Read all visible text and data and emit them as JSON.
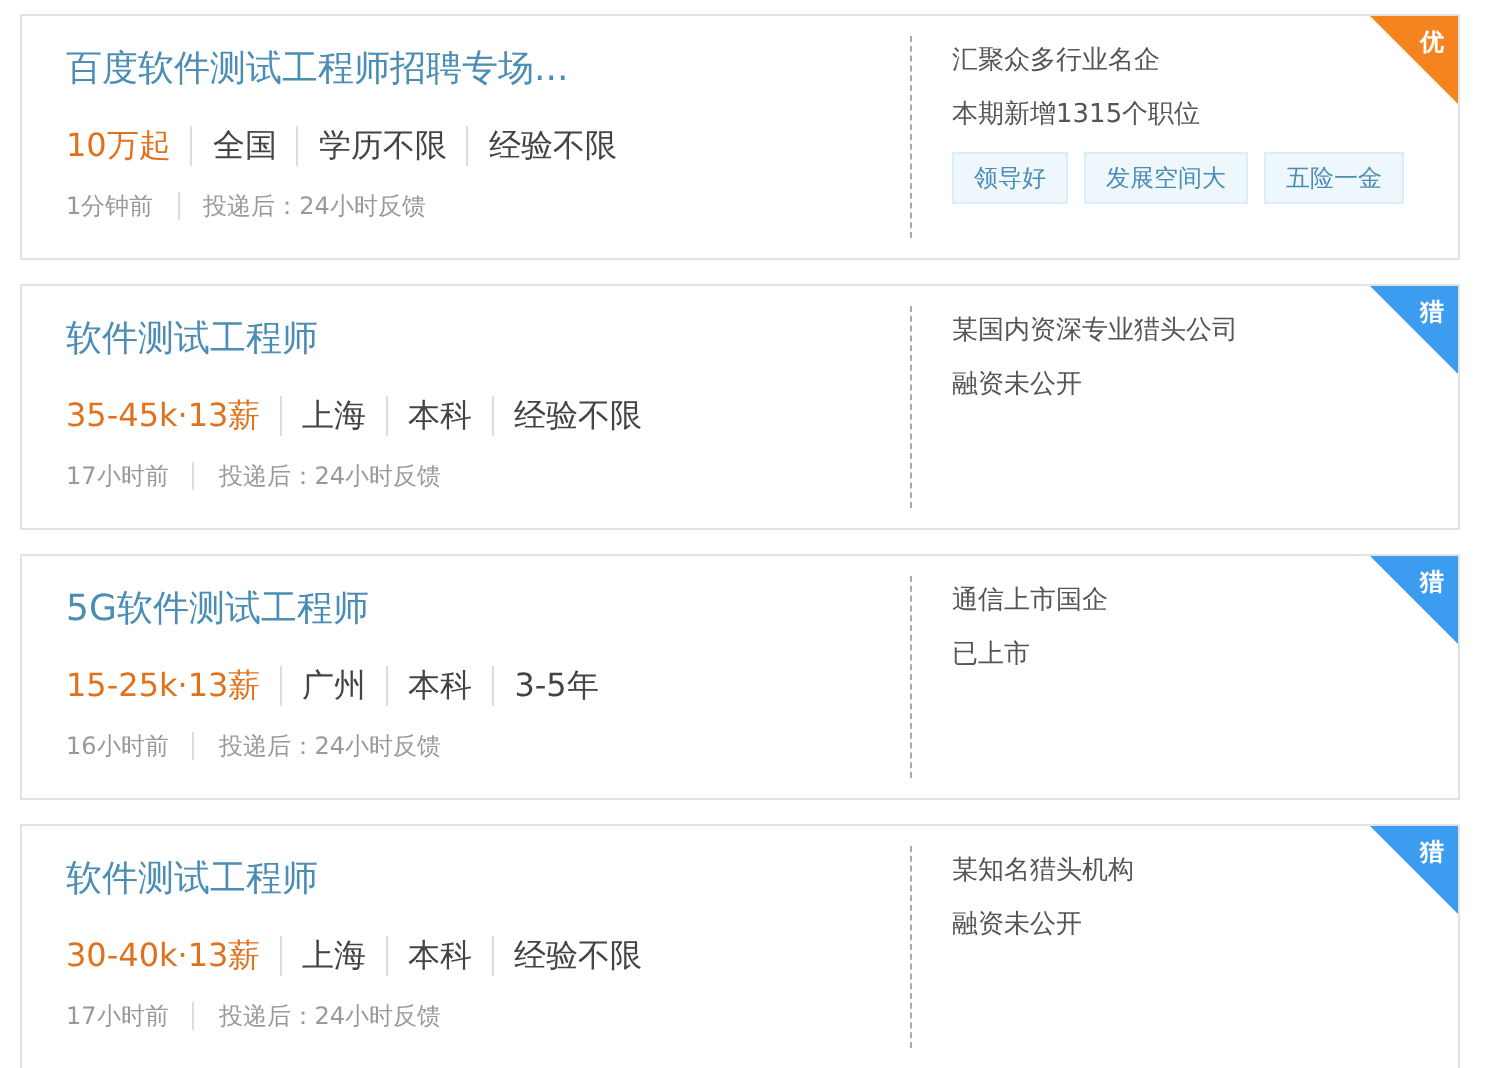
{
  "jobs": [
    {
      "title": "百度软件测试工程师招聘专场...",
      "salary": "10万起",
      "requirements": [
        "全国",
        "学历不限",
        "经验不限"
      ],
      "posted": "1分钟前",
      "feedback": "投递后：24小时反馈",
      "company_lines": [
        "汇聚众多行业名企",
        "本期新增1315个职位"
      ],
      "tags": [
        "领导好",
        "发展空间大",
        "五险一金"
      ],
      "corner": {
        "label": "优",
        "color": "#f5831f"
      }
    },
    {
      "title": "软件测试工程师",
      "salary": "35-45k·13薪",
      "requirements": [
        "上海",
        "本科",
        "经验不限"
      ],
      "posted": "17小时前",
      "feedback": "投递后：24小时反馈",
      "company_lines": [
        "某国内资深专业猎头公司",
        "融资未公开"
      ],
      "corner": {
        "label": "猎",
        "color": "#3b9cf0"
      }
    },
    {
      "title": "5G软件测试工程师",
      "salary": "15-25k·13薪",
      "requirements": [
        "广州",
        "本科",
        "3-5年"
      ],
      "posted": "16小时前",
      "feedback": "投递后：24小时反馈",
      "company_lines": [
        "通信上市国企",
        "已上市"
      ],
      "corner": {
        "label": "猎",
        "color": "#3b9cf0"
      }
    },
    {
      "title": "软件测试工程师",
      "salary": "30-40k·13薪",
      "requirements": [
        "上海",
        "本科",
        "经验不限"
      ],
      "posted": "17小时前",
      "feedback": "投递后：24小时反馈",
      "company_lines": [
        "某知名猎头机构",
        "融资未公开"
      ],
      "corner": {
        "label": "猎",
        "color": "#3b9cf0"
      }
    }
  ]
}
